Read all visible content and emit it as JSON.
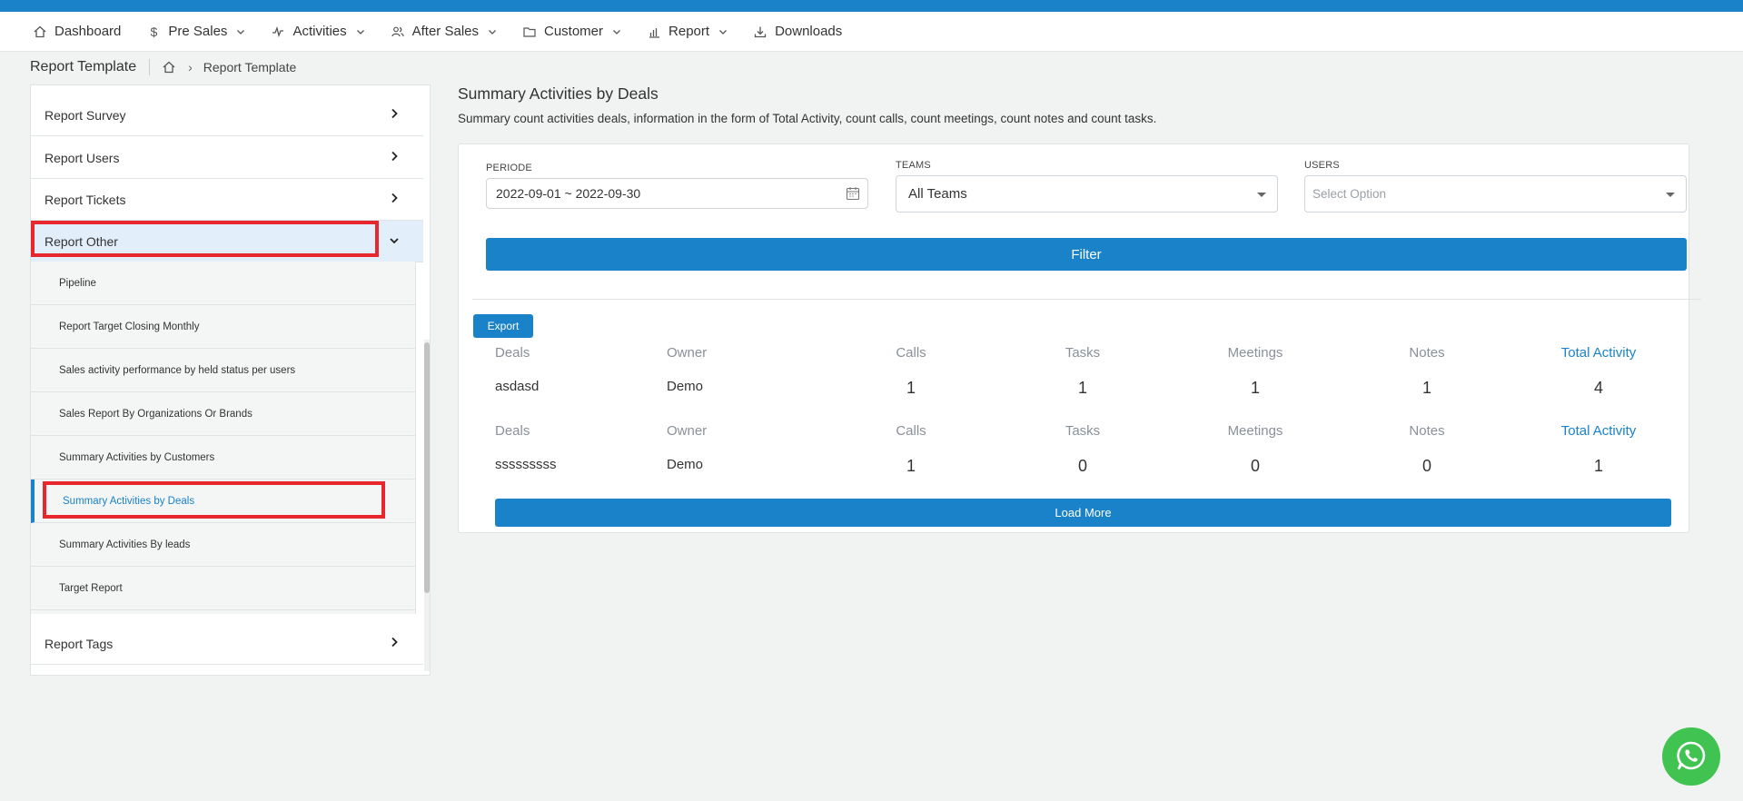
{
  "nav": {
    "items": [
      {
        "label": "Dashboard"
      },
      {
        "label": "Pre Sales"
      },
      {
        "label": "Activities"
      },
      {
        "label": "After Sales"
      },
      {
        "label": "Customer"
      },
      {
        "label": "Report"
      },
      {
        "label": "Downloads"
      }
    ]
  },
  "breadcrumb": {
    "title": "Report Template",
    "separator": "›",
    "current": "Report Template"
  },
  "sidebar": {
    "items": [
      {
        "label": "Report Survey"
      },
      {
        "label": "Report Users"
      },
      {
        "label": "Report Tickets"
      },
      {
        "label": "Report Other"
      },
      {
        "label": "Report Tags"
      }
    ],
    "sub_items": [
      {
        "label": "Pipeline"
      },
      {
        "label": "Report Target Closing Monthly"
      },
      {
        "label": "Sales activity performance by held status per users"
      },
      {
        "label": "Sales Report By Organizations Or Brands"
      },
      {
        "label": "Summary Activities by Customers"
      },
      {
        "label": "Summary Activities by Deals"
      },
      {
        "label": "Summary Activities By leads"
      },
      {
        "label": "Target Report"
      }
    ]
  },
  "content": {
    "title": "Summary Activities by Deals",
    "description": "Summary count activities deals, information in the form of Total Activity, count calls, count meetings, count notes and count tasks."
  },
  "filters": {
    "periode_label": "PERIODE",
    "periode_value": "2022-09-01 ~ 2022-09-30",
    "teams_label": "TEAMS",
    "teams_value": "All Teams",
    "users_label": "USERS",
    "users_placeholder": "Select Option",
    "filter_button": "Filter"
  },
  "export_button": "Export",
  "table": {
    "headers": [
      "Deals",
      "Owner",
      "Calls",
      "Tasks",
      "Meetings",
      "Notes",
      "Total Activity"
    ],
    "rows": [
      {
        "deal": "asdasd",
        "owner": "Demo",
        "calls": "1",
        "tasks": "1",
        "meetings": "1",
        "notes": "1",
        "total": "4"
      },
      {
        "deal": "sssssssss",
        "owner": "Demo",
        "calls": "1",
        "tasks": "0",
        "meetings": "0",
        "notes": "0",
        "total": "1"
      }
    ]
  },
  "load_more_button": "Load More",
  "colors": {
    "primary": "#1a82c8",
    "highlight_box": "#e8262d",
    "whatsapp": "#40c351"
  }
}
